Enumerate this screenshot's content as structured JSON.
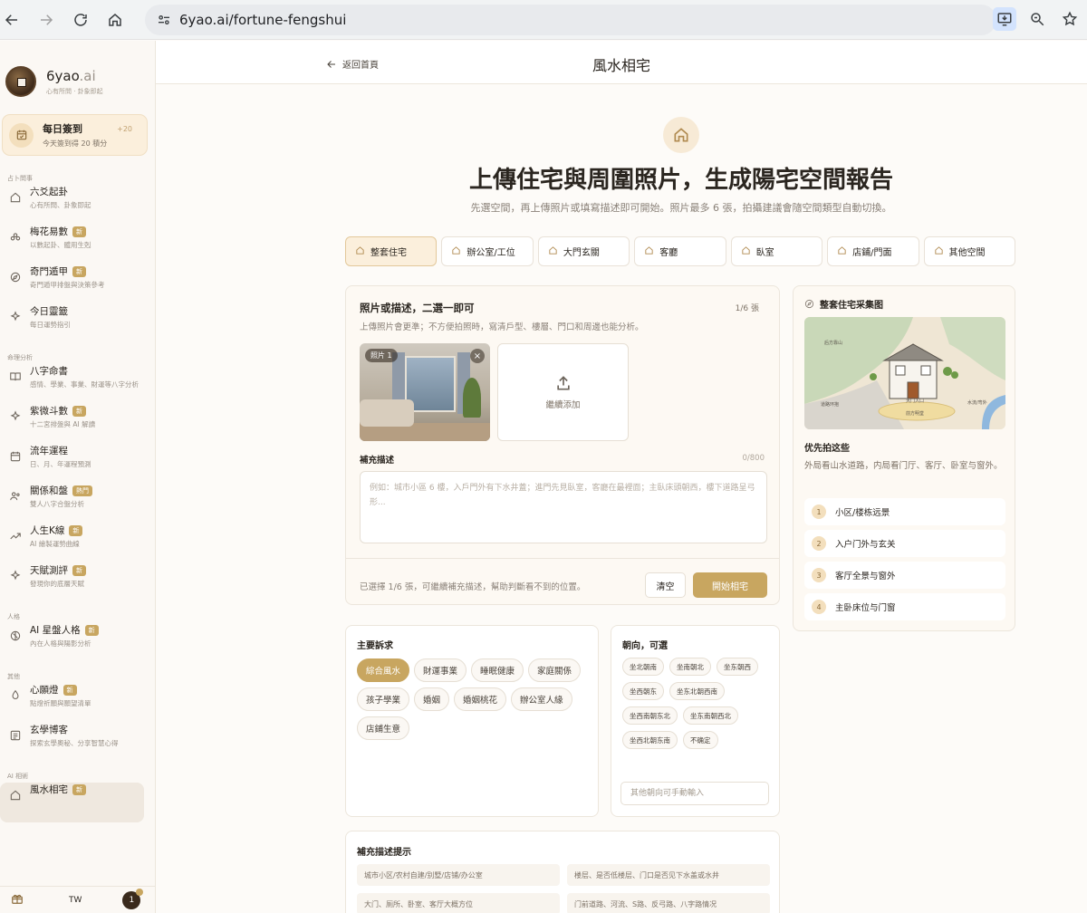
{
  "browser": {
    "url": "6yao.ai/fortune-fengshui"
  },
  "sidebar": {
    "brand_name": "6yao",
    "brand_suffix": ".ai",
    "brand_tagline": "心有所問 · 卦象即起",
    "checkin_title": "每日簽到",
    "checkin_sub": "今天簽到得 20 積分",
    "checkin_points": "+20",
    "sections": [
      {
        "title": "占卜問事",
        "items": [
          {
            "label": "六爻起卦",
            "desc": "心有所問、卦象即起",
            "badge": ""
          },
          {
            "label": "梅花易數",
            "desc": "以數起卦、體用生剋",
            "badge": "新"
          },
          {
            "label": "奇門遁甲",
            "desc": "奇門遁甲排盤與決策參考",
            "badge": "新"
          },
          {
            "label": "今日靈籤",
            "desc": "每日運勢指引",
            "badge": ""
          }
        ]
      },
      {
        "title": "命理分析",
        "items": [
          {
            "label": "八字命書",
            "desc": "感情、學業、事業、財運等八字分析",
            "badge": ""
          },
          {
            "label": "紫微斗數",
            "desc": "十二宮排盤與 AI 解讀",
            "badge": "新"
          },
          {
            "label": "流年運程",
            "desc": "日、月、年運程預測",
            "badge": ""
          },
          {
            "label": "關係和盤",
            "desc": "雙人八字合盤分析",
            "badge": "熱門"
          },
          {
            "label": "人生K線",
            "desc": "AI 繪製運勢曲線",
            "badge": "新"
          },
          {
            "label": "天賦測評",
            "desc": "發現你的底層天賦",
            "badge": "新"
          }
        ]
      },
      {
        "title": "人格",
        "items": [
          {
            "label": "AI 星盤人格",
            "desc": "內在人格與陽影分析",
            "badge": "新"
          }
        ]
      },
      {
        "title": "其他",
        "items": [
          {
            "label": "心願燈",
            "desc": "點燈祈願與願望清單",
            "badge": "新"
          },
          {
            "label": "玄學博客",
            "desc": "探索玄學奧秘、分享智慧心得",
            "badge": ""
          }
        ]
      },
      {
        "title": "AI 相術",
        "items": [
          {
            "label": "風水相宅",
            "desc": "",
            "badge": "新"
          }
        ]
      }
    ],
    "lang": "TW",
    "notif_count": "1"
  },
  "topbar": {
    "back_label": "返回首頁",
    "title": "風水相宅"
  },
  "hero": {
    "title": "上傳住宅與周圍照片，生成陽宅空間報告",
    "subtitle": "先選空間，再上傳照片或填寫描述即可開始。照片最多 6 張，拍攝建議會隨空間類型自動切換。"
  },
  "space_types": [
    "整套住宅",
    "辦公室/工位",
    "大門玄關",
    "客廳",
    "臥室",
    "店鋪/門面",
    "其他空間"
  ],
  "upload": {
    "title": "照片或描述，二選一即可",
    "count": "1/6 張",
    "subtitle": "上傳照片會更準；不方便拍照時，寫清戶型、樓層、門口和周邊也能分析。",
    "photo_tag": "照片 1",
    "add_label": "繼續添加",
    "desc_label": "補充描述",
    "desc_count": "0/800",
    "desc_placeholder": "例如：城市小區 6 樓，入戶門外有下水井蓋；進門先見臥室，客廳在最裡面；主臥床頭朝西，樓下道路呈弓形...",
    "status": "已選擇 1/6 張，可繼續補充描述，幫助判斷看不到的位置。",
    "clear_label": "清空",
    "start_label": "開始相宅"
  },
  "guide": {
    "title": "整套住宅采集图",
    "map_labels": [
      "后方靠山",
      "道路环抱",
      "大门入口",
      "前方明堂",
      "水流/弯外"
    ],
    "priority_title": "优先拍这些",
    "priority_desc": "外局看山水道路，内局看门厅、客厅、卧室与窗外。",
    "steps": [
      {
        "num": "1",
        "label": "小区/楼栋远景"
      },
      {
        "num": "2",
        "label": "入户门外与玄关"
      },
      {
        "num": "3",
        "label": "客厅全景与窗外"
      },
      {
        "num": "4",
        "label": "主卧床位与门窗"
      }
    ]
  },
  "focus": {
    "title": "主要訴求",
    "options": [
      "綜合風水",
      "財運事業",
      "睡眠健康",
      "家庭關係",
      "孩子學業",
      "婚姻",
      "婚姻桃花",
      "辦公室人緣",
      "店鋪生意"
    ],
    "selected": "綜合風水"
  },
  "direction": {
    "title": "朝向，可選",
    "options": [
      "坐北朝南",
      "坐南朝北",
      "坐东朝西",
      "坐西朝东",
      "坐东北朝西南",
      "坐西南朝东北",
      "坐东南朝西北",
      "坐西北朝东南",
      "不确定"
    ],
    "placeholder": "其他朝向可手動輸入"
  },
  "hints": {
    "title": "補充描述提示",
    "items": [
      "城市小区/农村自建/别墅/店铺/办公室",
      "楼层、是否低楼层、门口是否见下水盖或水井",
      "大门、厕所、卧室、客厅大概方位",
      "门前道路、河流、S路、反弓路、八字路情况"
    ]
  },
  "colors": {
    "accent": "#c8a660",
    "accent_light": "#fbefdc",
    "text": "#2b2620",
    "muted": "#8a8178"
  }
}
